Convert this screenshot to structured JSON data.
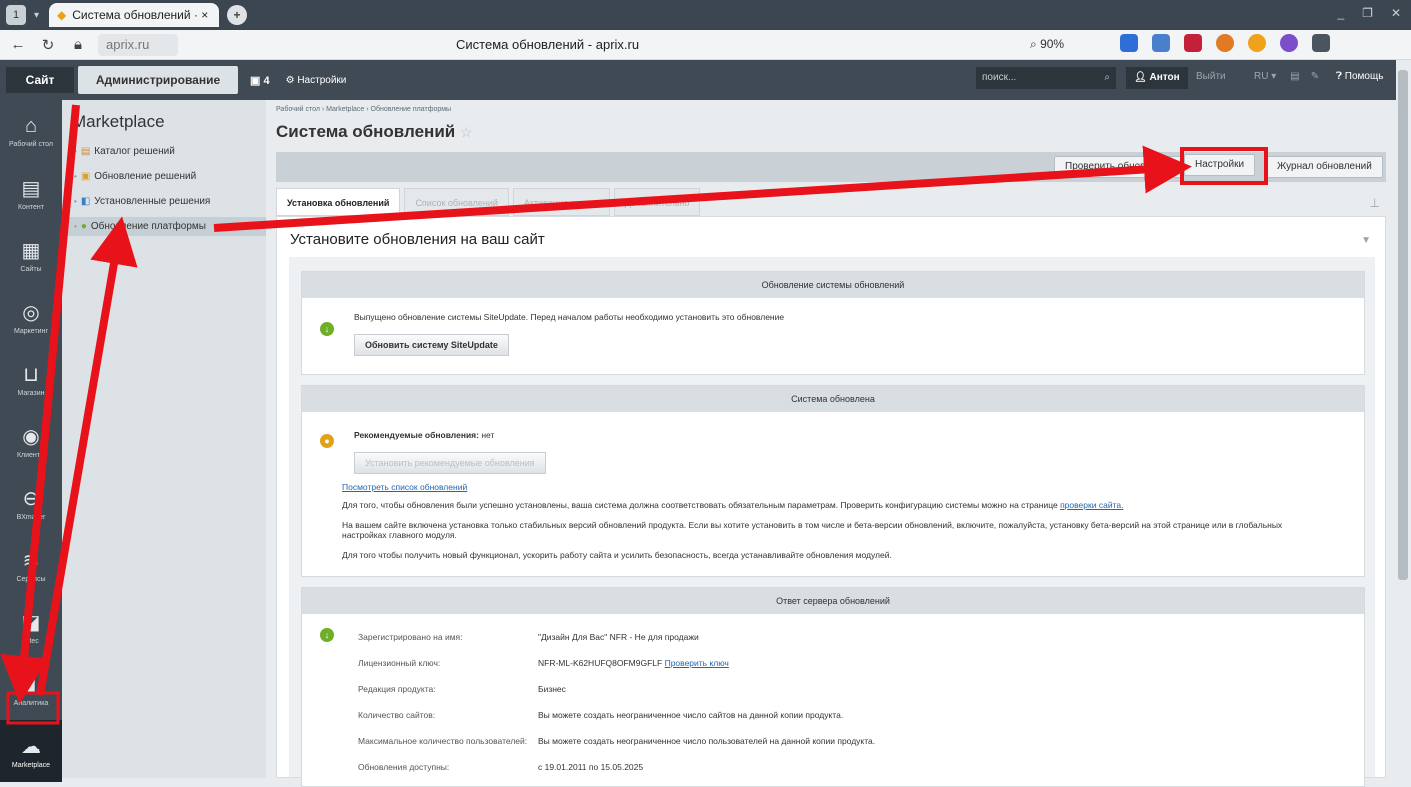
{
  "browser": {
    "tab_title": "Система обновлений · ×",
    "url": "aprix.ru",
    "page_title": "Система обновлений - aprix.ru",
    "zoom": "90%"
  },
  "adminbar": {
    "site": "Сайт",
    "admin": "Администрирование",
    "notifications": "4",
    "settings": "Настройки",
    "search_placeholder": "поиск...",
    "user": "Антон",
    "logout": "Выйти",
    "lang": "RU",
    "help": "Помощь"
  },
  "leftnav": [
    {
      "label": "Рабочий стол",
      "icon": "home-icon"
    },
    {
      "label": "Контент",
      "icon": "document-icon"
    },
    {
      "label": "Сайты",
      "icon": "calendar-icon"
    },
    {
      "label": "Маркетинг",
      "icon": "target-icon"
    },
    {
      "label": "Магазин",
      "icon": "basket-icon"
    },
    {
      "label": "Клиенты",
      "icon": "clients-icon"
    },
    {
      "label": "BXmaker",
      "icon": "bxmaker-icon"
    },
    {
      "label": "Сервисы",
      "icon": "services-icon"
    },
    {
      "label": "Altec",
      "icon": "altec-icon"
    },
    {
      "label": "Аналитика",
      "icon": "analytics-icon"
    },
    {
      "label": "Marketplace",
      "icon": "cloud-download-icon"
    }
  ],
  "menu": {
    "title": "Marketplace",
    "items": [
      "Каталог решений",
      "Обновление решений",
      "Установленные решения",
      "Обновление платформы"
    ]
  },
  "main": {
    "breadcrumb": "Рабочий стол  ›  Marketplace  ›  Обновление платформы",
    "title": "Система обновлений",
    "btn_check": "Проверить обновления",
    "btn_settings": "Настройки",
    "btn_journal": "Журнал обновлений",
    "tabs": [
      "Установка обновлений",
      "Список обновлений",
      "Активация купона",
      "Дополнительно"
    ],
    "panel_heading": "Установите обновления на ваш сайт"
  },
  "box1": {
    "header": "Обновление системы обновлений",
    "text": "Выпущено обновление системы SiteUpdate. Перед началом работы необходимо установить это обновление",
    "button": "Обновить систему SiteUpdate"
  },
  "box2": {
    "header": "Система обновлена",
    "recommended_label": "Рекомендуемые обновления:",
    "recommended_value": "нет",
    "install_btn": "Установить рекомендуемые обновления",
    "view_list": "Посмотреть список обновлений",
    "p1": "Для того, чтобы обновления были успешно установлены, ваша система должна соответствовать обязательным параметрам. Проверить конфигурацию системы можно на странице",
    "p1_link": "проверки сайта.",
    "p2a": "На вашем сайте включена установка только стабильных версий обновлений продукта. Если вы хотите установить в том числе и бета-версии обновлений, включите, пожалуйста, установку бета-версий на этой странице или в глобальных",
    "p2b": "настройках главного модуля.",
    "p3": "Для того чтобы получить новый функционал, ускорить работу сайта и усилить безопасность, всегда устанавливайте обновления модулей."
  },
  "box3": {
    "header": "Ответ сервера обновлений",
    "rows": [
      {
        "k": "Зарегистрировано на имя:",
        "v": "\"Дизайн Для Вас\" NFR - Не для продажи"
      },
      {
        "k": "Лицензионный ключ:",
        "v": "NFR-ML-K62HUFQ8OFM9GFLF",
        "link": "Проверить ключ"
      },
      {
        "k": "Редакция продукта:",
        "v": "Бизнес"
      },
      {
        "k": "Количество сайтов:",
        "v": "Вы можете создать неограниченное число сайтов на данной копии продукта."
      },
      {
        "k": "Максимальное количество пользователей:",
        "v": "Вы можете создать неограниченное число пользователей на данной копии продукта."
      },
      {
        "k": "Обновления доступны:",
        "v": "с 19.01.2011 по 15.05.2025"
      }
    ]
  },
  "colors": {
    "annotation": "#e8131a",
    "adminbar": "#404a54",
    "ok": "#6fae28"
  }
}
